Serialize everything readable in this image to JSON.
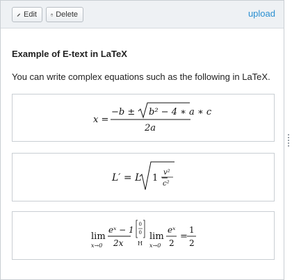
{
  "toolbar": {
    "edit_label": "Edit",
    "delete_label": "Delete",
    "upload_label": "upload"
  },
  "content": {
    "heading": "Example of E-text in LaTeX",
    "intro": "You can write complex equations such as the following in LaTeX."
  },
  "equations": {
    "eq1": {
      "lhs": "x =",
      "numerator_prefix": "−b ±",
      "radicand": "b² − 4 ∗ a ∗ c",
      "denominator": "2a"
    },
    "eq2": {
      "lhs": "L′ = L",
      "radicand_prefix": "1 −",
      "frac_num": "v²",
      "frac_den": "c²"
    },
    "eq3": {
      "lim_word": "lim",
      "lim_sub": "x→0",
      "frac1_num": "eˣ − 1",
      "frac1_den": "2x",
      "hospital_top": "0",
      "hospital_bottom": "0",
      "hospital_label": "H",
      "frac2_num": "eˣ",
      "frac2_den": "2",
      "equals": "=",
      "frac3_num": "1",
      "frac3_den": "2"
    }
  },
  "colors": {
    "link": "#2a8fd1",
    "toolbar_bg": "#eef1f4",
    "border": "#c9ced3"
  },
  "icons": {
    "edit": "pencil-icon",
    "delete": "trash-icon"
  }
}
